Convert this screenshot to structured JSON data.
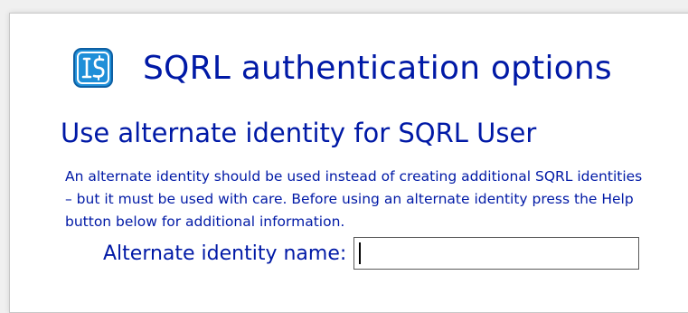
{
  "window": {
    "app_title": "SQRL authentication options",
    "logo_icon": "sqrl-logo-icon"
  },
  "dialog": {
    "heading": "Use alternate identity for SQRL User",
    "description": "An alternate identity should be used instead of creating additional SQRL identities – but it must be used with care. Before using an alternate identity press the Help button below for additional information.",
    "field": {
      "label": "Alternate identity name:",
      "value": "",
      "placeholder": ""
    }
  },
  "colors": {
    "text": "#0019a6",
    "logo_bg": "#1f8fd8",
    "window_bg": "#ffffff"
  }
}
